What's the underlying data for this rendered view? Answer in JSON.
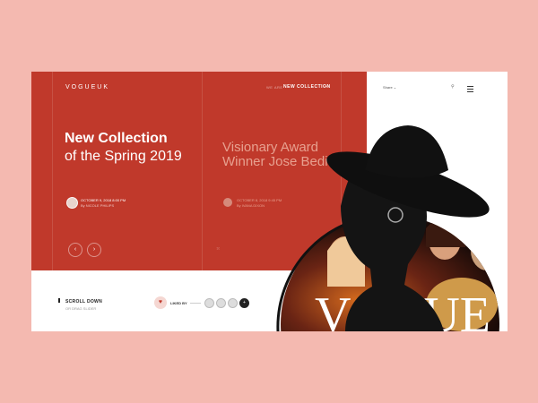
{
  "header": {
    "brand": "VOGUEUK",
    "nav_small": "WE ARE",
    "nav_main": "NEW COLLECTION",
    "share": "Share",
    "arrow": "→"
  },
  "hero": {
    "title_line1": "New Collection",
    "title_line2": "of the Spring 2019",
    "date": "OCTOBER 9, 2018 8:00 PM",
    "author": "By NICOLE PHILIPS",
    "prev": "‹",
    "next": "›"
  },
  "next_slide": {
    "title": "Visionary Award Winner Jose Bedia",
    "date": "OCTOBER 8, 2018 9:45 PM",
    "author": "By IVANA DIXON"
  },
  "footer": {
    "scroll_label": "SCROLL DOWN",
    "scroll_sub": "OR DRAG SLIDER",
    "liked_by": "LIKED BY",
    "more_count": "+"
  },
  "photo": {
    "letters": "VOGUE"
  },
  "colors": {
    "accent": "#c0392b",
    "background": "#f4b9b0"
  }
}
